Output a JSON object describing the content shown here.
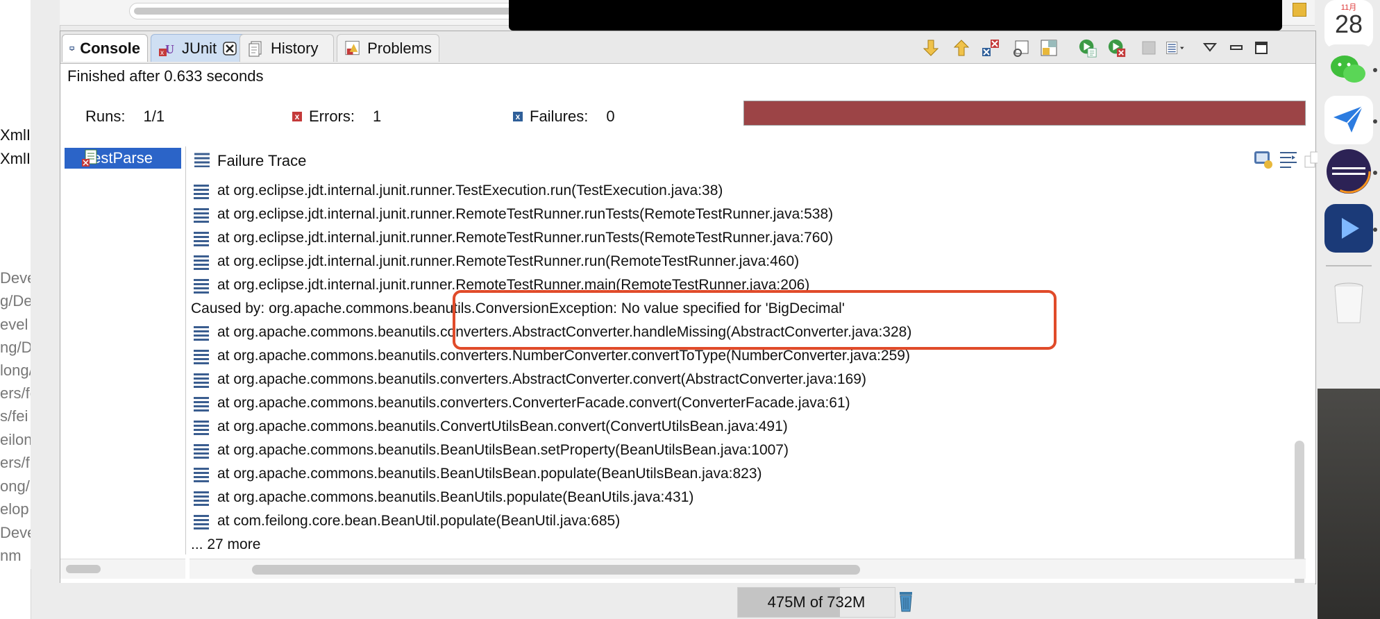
{
  "left_gutter": {
    "fragments": [
      "XmlI",
      "XmlI",
      "Deve",
      "g/De",
      "evel",
      "ng/D",
      "long/I",
      "ers/fe",
      "s/fei",
      "eilong",
      "ers/f",
      "ong/",
      "elop",
      "Deve",
      "nm"
    ]
  },
  "tabs": [
    {
      "label": "Console",
      "icon": "console-icon"
    },
    {
      "label": "JUnit",
      "icon": "junit-icon"
    },
    {
      "label": "History",
      "icon": "history-icon"
    },
    {
      "label": "Problems",
      "icon": "problems-icon"
    }
  ],
  "toolbar_icons": [
    "next-failure-icon",
    "previous-failure-icon",
    "show-failures-only-icon",
    "scroll-lock-icon",
    "history-menu-icon",
    "rerun-icon",
    "rerun-failed-first-icon",
    "stop-icon",
    "layout-menu-icon",
    "view-menu-icon",
    "minimize-icon",
    "maximize-icon"
  ],
  "status": "Finished after 0.633 seconds",
  "stats": {
    "runs_label": "Runs:",
    "runs_value": "1/1",
    "errors_label": "Errors:",
    "errors_value": "1",
    "failures_label": "Failures:",
    "failures_value": "0"
  },
  "progress": {
    "fraction": 1.0,
    "color": "#9c4446"
  },
  "tree": {
    "item_label": "testParse"
  },
  "failure_trace": {
    "title": "Failure Trace",
    "lines": [
      {
        "type": "frame",
        "text": "at org.eclipse.jdt.internal.junit.runner.TestExecution.run(TestExecution.java:38)"
      },
      {
        "type": "frame",
        "text": "at org.eclipse.jdt.internal.junit.runner.RemoteTestRunner.runTests(RemoteTestRunner.java:538)"
      },
      {
        "type": "frame",
        "text": "at org.eclipse.jdt.internal.junit.runner.RemoteTestRunner.runTests(RemoteTestRunner.java:760)"
      },
      {
        "type": "frame",
        "text": "at org.eclipse.jdt.internal.junit.runner.RemoteTestRunner.run(RemoteTestRunner.java:460)"
      },
      {
        "type": "frame",
        "text": "at org.eclipse.jdt.internal.junit.runner.RemoteTestRunner.main(RemoteTestRunner.java:206)"
      },
      {
        "type": "caused",
        "text": "Caused by: org.apache.commons.beanutils.ConversionException: No value specified for 'BigDecimal'"
      },
      {
        "type": "frame",
        "text": "at org.apache.commons.beanutils.converters.AbstractConverter.handleMissing(AbstractConverter.java:328)"
      },
      {
        "type": "frame",
        "text": "at org.apache.commons.beanutils.converters.NumberConverter.convertToType(NumberConverter.java:259)"
      },
      {
        "type": "frame",
        "text": "at org.apache.commons.beanutils.converters.AbstractConverter.convert(AbstractConverter.java:169)"
      },
      {
        "type": "frame",
        "text": "at org.apache.commons.beanutils.converters.ConverterFacade.convert(ConverterFacade.java:61)"
      },
      {
        "type": "frame",
        "text": "at org.apache.commons.beanutils.ConvertUtilsBean.convert(ConvertUtilsBean.java:491)"
      },
      {
        "type": "frame",
        "text": "at org.apache.commons.beanutils.BeanUtilsBean.setProperty(BeanUtilsBean.java:1007)"
      },
      {
        "type": "frame",
        "text": "at org.apache.commons.beanutils.BeanUtilsBean.populate(BeanUtilsBean.java:823)"
      },
      {
        "type": "frame",
        "text": "at org.apache.commons.beanutils.BeanUtils.populate(BeanUtils.java:431)"
      },
      {
        "type": "frame",
        "text": "at com.feilong.core.bean.BeanUtil.populate(BeanUtil.java:685)"
      },
      {
        "type": "more",
        "text": "... 27 more"
      }
    ]
  },
  "memory": {
    "text": "475M of 732M",
    "used_fraction": 0.649
  },
  "dock": {
    "calendar_day": "28",
    "calendar_month": "11月",
    "apps": [
      "calendar-icon",
      "wechat-icon",
      "mail-bird-icon",
      "eclipse-icon",
      "video-player-icon",
      "trash-icon"
    ]
  },
  "colors": {
    "highlight": "#e04b2a",
    "error_bar": "#9c4446",
    "selection": "#2b64c8"
  }
}
